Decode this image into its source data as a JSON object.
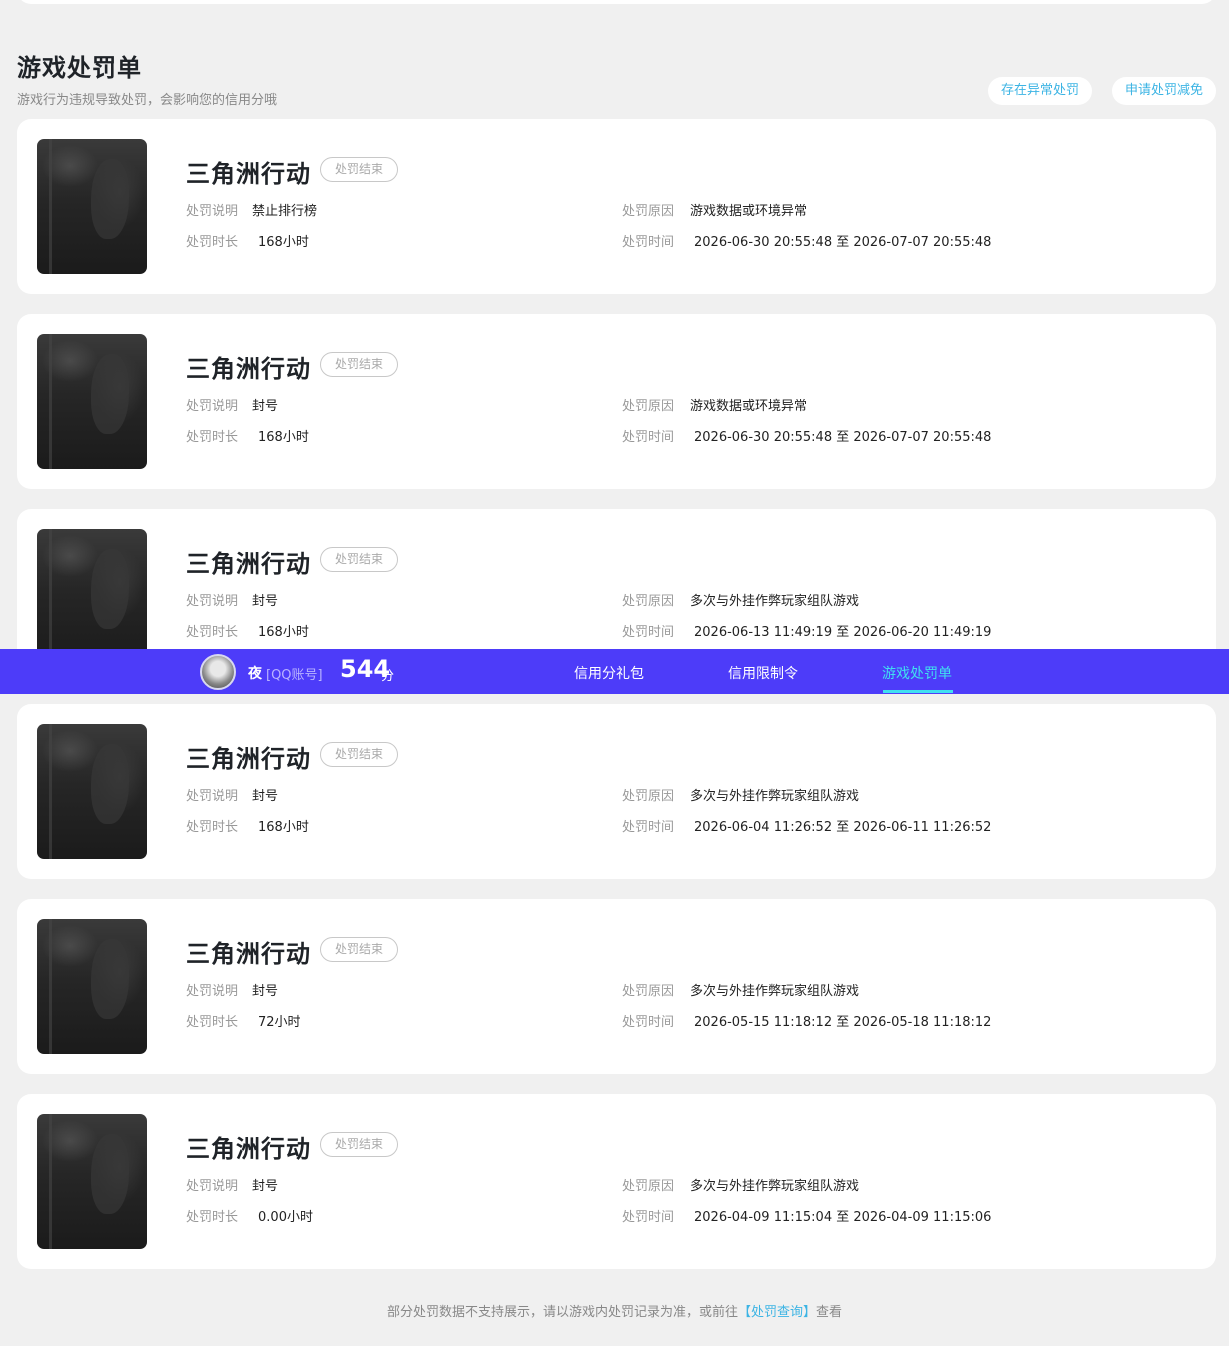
{
  "section": {
    "title": "游戏处罚单",
    "subtitle": "游戏行为违规导致处罚，会影响您的信用分哦",
    "btn_abnormal": "存在异常处罚",
    "btn_reduce": "申请处罚减免"
  },
  "labels": {
    "desc": "处罚说明",
    "duration": "处罚时长",
    "reason": "处罚原因",
    "time": "处罚时间"
  },
  "records": [
    {
      "game": "三角洲行动",
      "status": "处罚结束",
      "desc": "禁止排行榜",
      "duration": "168小时",
      "reason": "游戏数据或环境异常",
      "time": "2026-06-30 20:55:48 至 2026-07-07 20:55:48"
    },
    {
      "game": "三角洲行动",
      "status": "处罚结束",
      "desc": "封号",
      "duration": "168小时",
      "reason": "游戏数据或环境异常",
      "time": "2026-06-30 20:55:48 至 2026-07-07 20:55:48"
    },
    {
      "game": "三角洲行动",
      "status": "处罚结束",
      "desc": "封号",
      "duration": "168小时",
      "reason": "多次与外挂作弊玩家组队游戏",
      "time": "2026-06-13 11:49:19 至 2026-06-20 11:49:19"
    },
    {
      "game": "三角洲行动",
      "status": "处罚结束",
      "desc": "封号",
      "duration": "168小时",
      "reason": "多次与外挂作弊玩家组队游戏",
      "time": "2026-06-04 11:26:52 至 2026-06-11 11:26:52"
    },
    {
      "game": "三角洲行动",
      "status": "处罚结束",
      "desc": "封号",
      "duration": "72小时",
      "reason": "多次与外挂作弊玩家组队游戏",
      "time": "2026-05-15 11:18:12 至 2026-05-18 11:18:12"
    },
    {
      "game": "三角洲行动",
      "status": "处罚结束",
      "desc": "封号",
      "duration": "0.00小时",
      "reason": "多次与外挂作弊玩家组队游戏",
      "time": "2026-04-09 11:15:04 至 2026-04-09 11:15:06"
    }
  ],
  "navbar": {
    "nickname": "夜",
    "account_type": "[QQ账号]",
    "score": "544",
    "score_unit": "分",
    "tabs": [
      "信用分礼包",
      "信用限制令",
      "游戏处罚单"
    ],
    "active_tab": "游戏处罚单",
    "color": "#4d3cf9"
  },
  "footer": {
    "text_before": "部分处罚数据不支持展示，请以游戏内处罚记录为准，或前往",
    "link": "【处罚查询】",
    "text_after": "查看"
  },
  "colors": {
    "accent": "#3cb4e4",
    "active_tab": "#40e0f0"
  }
}
